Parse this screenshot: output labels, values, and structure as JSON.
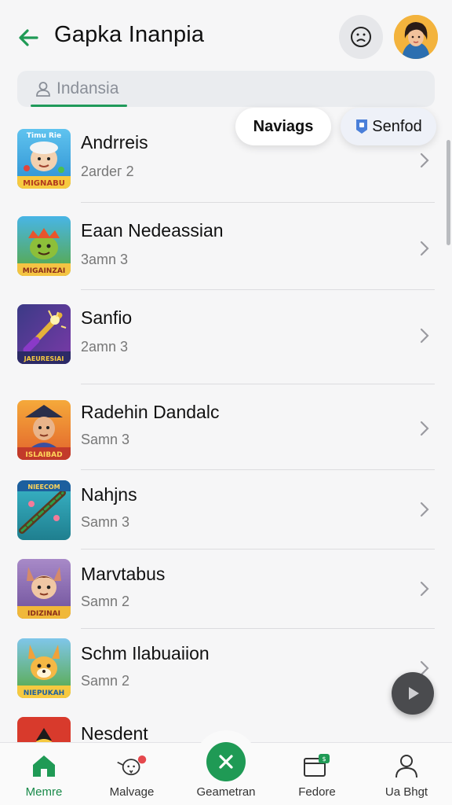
{
  "header": {
    "title": "Gapka Inanpia",
    "back_icon": "arrow-left-icon",
    "face_icon": "sad-face-icon",
    "avatar_icon": "user-avatar"
  },
  "search": {
    "placeholder": "Indansia",
    "icon": "user-icon"
  },
  "chips": {
    "navigate": "Naviags",
    "senfod": "Senfod"
  },
  "list": [
    {
      "title": "Andrreis",
      "subtitle": "2ardeг 2",
      "thumb_label": "MIGNABU"
    },
    {
      "title": "Eaan Nedeassian",
      "subtitle": "3amn 3",
      "thumb_label": "MIGAINZAI"
    },
    {
      "title": "Sanfio",
      "subtitle": "2amn 3",
      "thumb_label": "JAEURESIAI"
    },
    {
      "title": "Radehin Dandalc",
      "subtitle": "Samn 3",
      "thumb_label": "ISLAIBAD"
    },
    {
      "title": "Nahjns",
      "subtitle": "Samn 3",
      "thumb_label": "NIEECOM"
    },
    {
      "title": "Marvtabus",
      "subtitle": "Samn 2",
      "thumb_label": "IDIZINAI"
    },
    {
      "title": "Schm Ilabuaiion",
      "subtitle": "Samn 2",
      "thumb_label": "NIEPUKAH"
    },
    {
      "title": "Nesdent",
      "subtitle": "",
      "thumb_label": ""
    }
  ],
  "bottom_nav": [
    {
      "label": "Memre",
      "icon": "home-icon"
    },
    {
      "label": "Malvage",
      "icon": "bird-icon"
    },
    {
      "label": "Geametran",
      "icon": "close-icon"
    },
    {
      "label": "Fedore",
      "icon": "card-icon"
    },
    {
      "label": "Ua Bhgt",
      "icon": "person-icon"
    }
  ],
  "colors": {
    "accent": "#1f9a55",
    "notification": "#e5484d"
  }
}
